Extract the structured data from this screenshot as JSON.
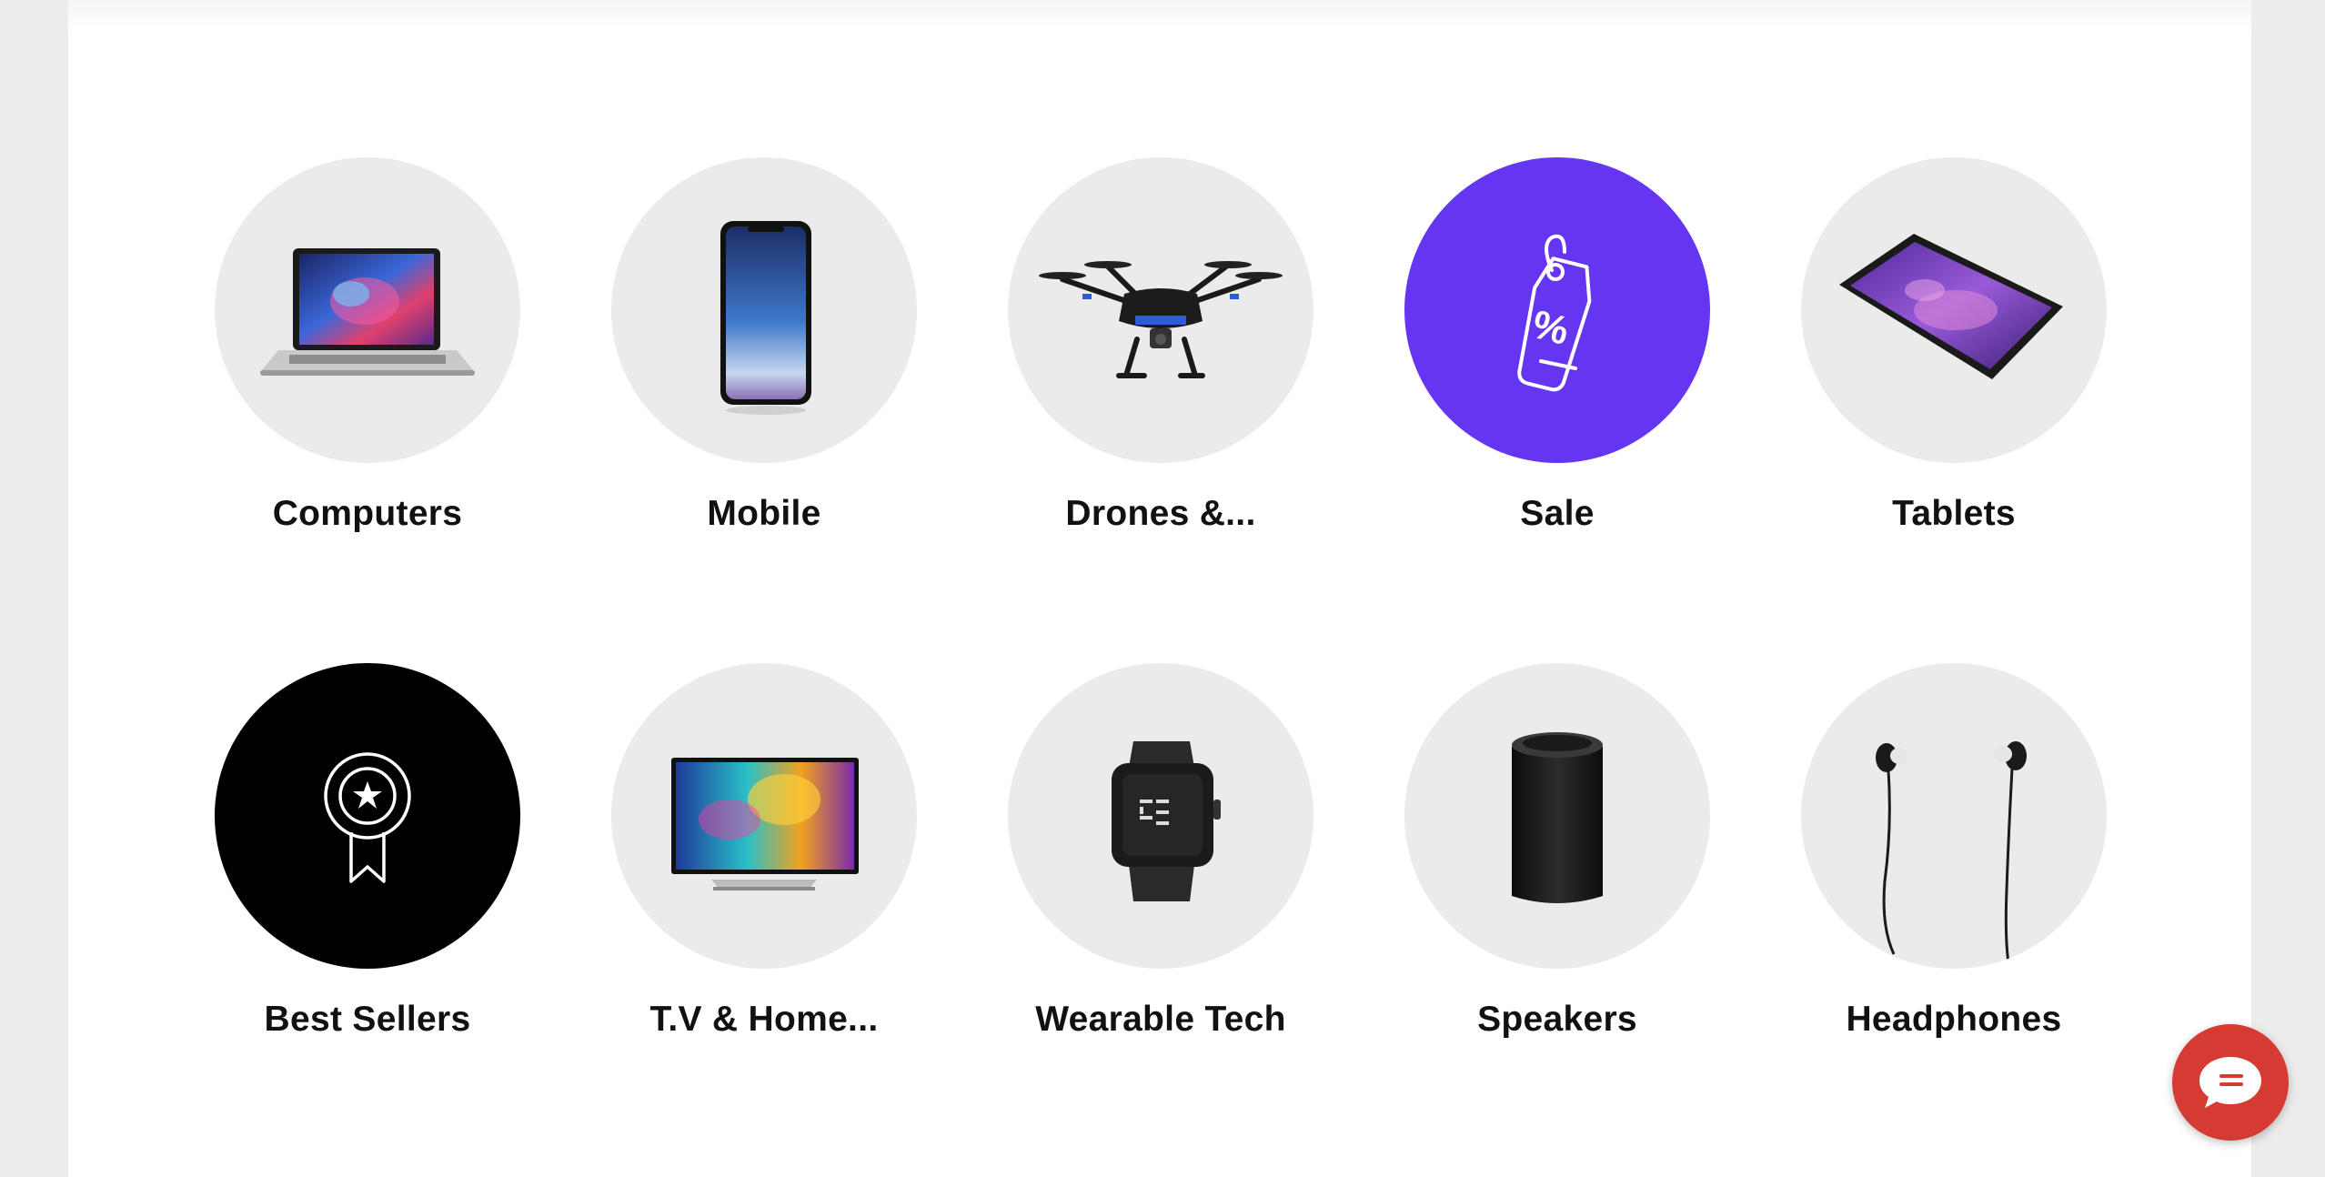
{
  "categories": [
    {
      "label": "Computers",
      "icon": "laptop-icon",
      "bg": "#ebebeb"
    },
    {
      "label": "Mobile",
      "icon": "smartphone-icon",
      "bg": "#ebebeb"
    },
    {
      "label": "Drones &...",
      "icon": "drone-icon",
      "bg": "#ebebeb"
    },
    {
      "label": "Sale",
      "icon": "price-tag-icon",
      "bg": "#6535f2"
    },
    {
      "label": "Tablets",
      "icon": "tablet-icon",
      "bg": "#ebebeb"
    },
    {
      "label": "Best Sellers",
      "icon": "award-ribbon-icon",
      "bg": "#000000"
    },
    {
      "label": "T.V & Home...",
      "icon": "television-icon",
      "bg": "#ebebeb"
    },
    {
      "label": "Wearable Tech",
      "icon": "smartwatch-icon",
      "bg": "#ebebeb"
    },
    {
      "label": "Speakers",
      "icon": "speaker-icon",
      "bg": "#ebebeb"
    },
    {
      "label": "Headphones",
      "icon": "earphones-icon",
      "bg": "#ebebeb"
    }
  ],
  "chat": {
    "icon": "chat-bubble-icon",
    "color": "#d63b33"
  },
  "colors": {
    "accent": "#6535f2",
    "page_bg": "#ececec",
    "circle_bg": "#ebebeb"
  }
}
